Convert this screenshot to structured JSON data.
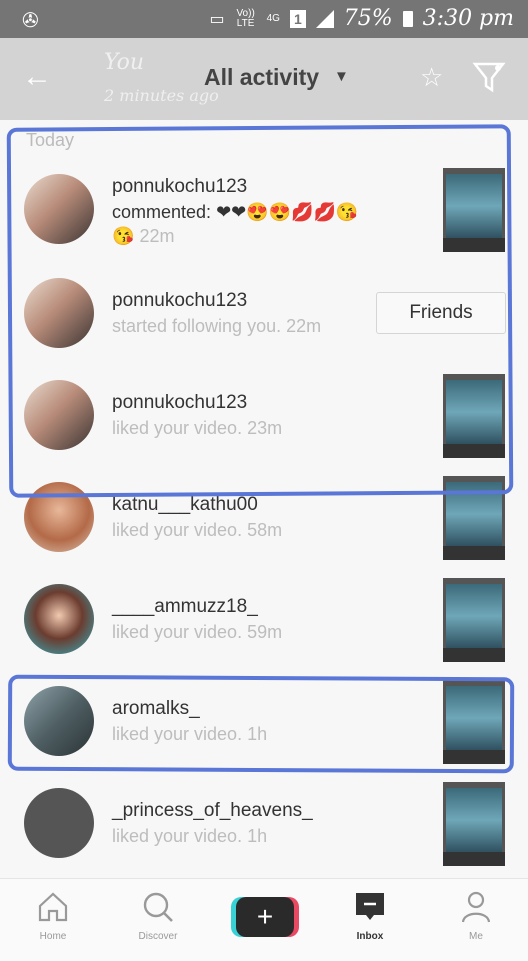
{
  "status_bar": {
    "network_small": "Vo)) LTE",
    "network_type": "4G",
    "sim": "1",
    "battery": "75%",
    "time": "3:30 pm"
  },
  "header": {
    "title": "All activity",
    "overlay_name": "You",
    "overlay_time": "2 minutes ago"
  },
  "section_label": "Today",
  "notifications": [
    {
      "user": "ponnukochu123",
      "action": "commented:",
      "emoji": "❤❤😍😍💋💋😘",
      "emoji2": "😘",
      "time": "22m"
    },
    {
      "user": "ponnukochu123",
      "action": "started following you.",
      "time": "22m",
      "button": "Friends"
    },
    {
      "user": "ponnukochu123",
      "action": "liked your video.",
      "time": "23m"
    },
    {
      "user": "katnu___kathu00",
      "action": "liked your video.",
      "time": "58m"
    },
    {
      "user": "____ammuzz18_",
      "action": "liked your video.",
      "time": "59m"
    },
    {
      "user": "aromalks_",
      "action": "liked your video.",
      "time": "1h"
    },
    {
      "user": "_princess_of_heavens_",
      "action": "liked your video.",
      "time": "1h"
    }
  ],
  "tabs": {
    "home": "Home",
    "discover": "Discover",
    "create": "+",
    "inbox": "Inbox",
    "me": "Me"
  },
  "colors": {
    "highlight": "#5a76d6",
    "header_bg": "#d3d3d3",
    "status_bg": "#757575"
  }
}
